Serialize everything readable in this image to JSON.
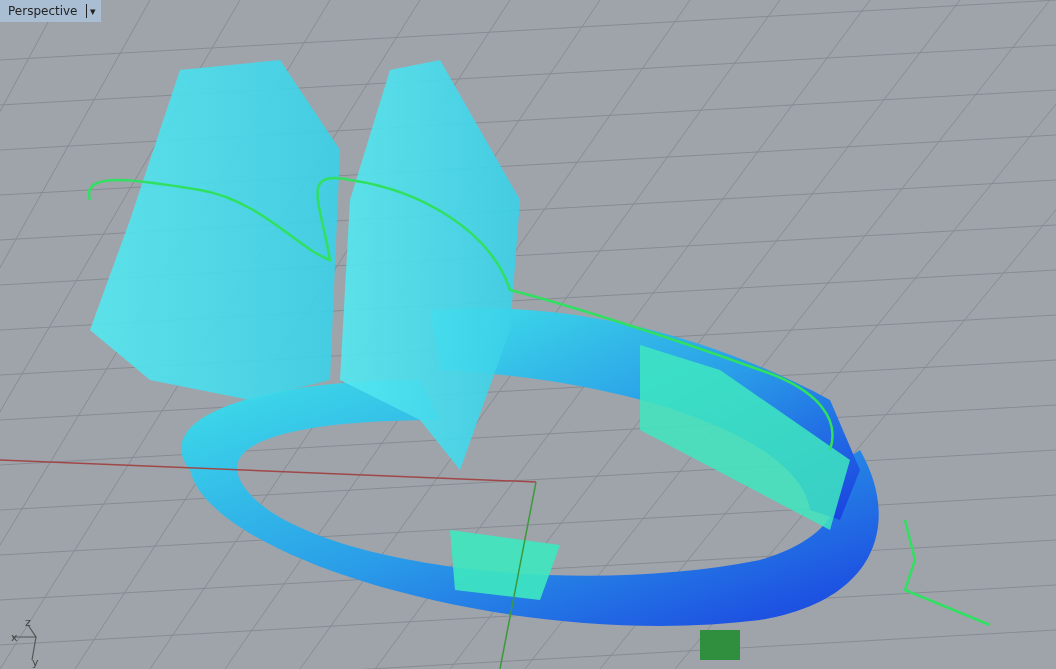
{
  "viewport": {
    "title": "Perspective",
    "menu": "▾"
  },
  "axis_triad": [
    {
      "label": "z"
    },
    {
      "label": "x"
    },
    {
      "label": "y"
    }
  ]
}
